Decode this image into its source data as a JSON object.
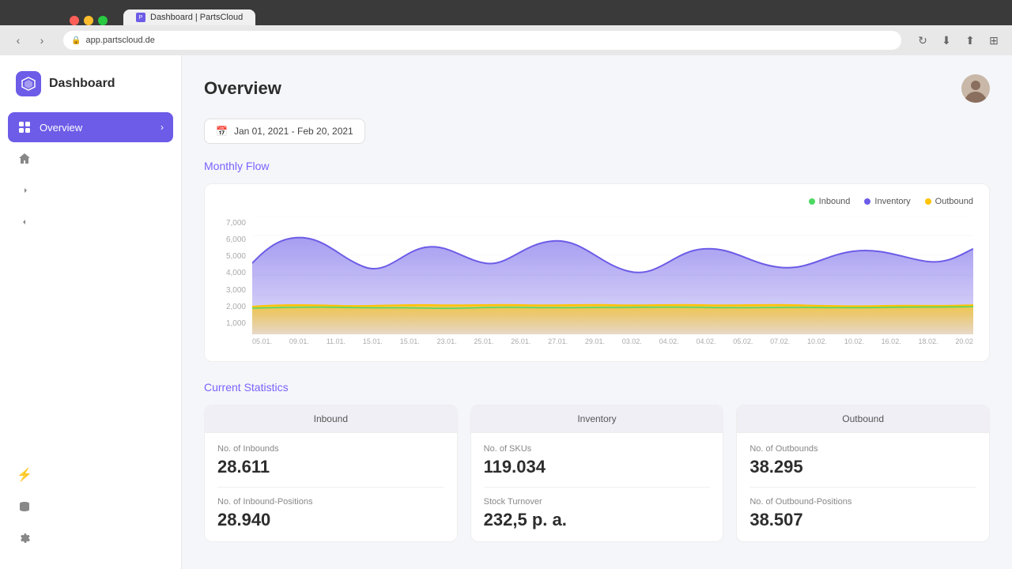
{
  "browser": {
    "tab_title": "Dashboard | PartsCloud",
    "url": "app.partscloud.de",
    "back_btn": "‹",
    "forward_btn": "›"
  },
  "sidebar": {
    "app_name": "Dashboard",
    "logo_symbol": "⬡",
    "nav_items": [
      {
        "id": "overview",
        "label": "Overview",
        "icon": "⊙",
        "active": true
      },
      {
        "id": "home",
        "label": "Home",
        "icon": "⌂",
        "active": false
      },
      {
        "id": "inbound",
        "label": "Inbound",
        "icon": "→",
        "active": false
      },
      {
        "id": "outbound",
        "label": "Outbound",
        "icon": "↗",
        "active": false
      }
    ],
    "bottom_items": [
      {
        "id": "lightning",
        "label": "",
        "icon": "⚡"
      },
      {
        "id": "database",
        "label": "",
        "icon": "⊟"
      },
      {
        "id": "settings",
        "label": "",
        "icon": "⊞"
      }
    ]
  },
  "header": {
    "title": "Overview",
    "date_range": "Jan 01, 2021 - Feb 20, 2021"
  },
  "monthly_flow": {
    "section_title": "Monthly Flow",
    "legend": [
      {
        "label": "Inbound",
        "color": "#4cd964"
      },
      {
        "label": "Inventory",
        "color": "#6c5ce7"
      },
      {
        "label": "Outbound",
        "color": "#ffc300"
      }
    ],
    "y_labels": [
      "7,000",
      "6,000",
      "5,000",
      "4,000",
      "3,000",
      "2,000",
      "1,000"
    ],
    "x_labels": [
      "05.01.",
      "09.01.",
      "11.01.",
      "15.01.",
      "15.01.",
      "23.01.",
      "25.01.",
      "26.01.",
      "27.01.",
      "29.01.",
      "03.02.",
      "04.02.",
      "04.02.",
      "05.02.",
      "07.02.",
      "10.02.",
      "10.02.",
      "16.02.",
      "18.02.",
      "20.02"
    ]
  },
  "current_statistics": {
    "section_title": "Current Statistics",
    "columns": [
      {
        "header": "Inbound",
        "stats": [
          {
            "label": "No. of Inbounds",
            "value": "28.611"
          },
          {
            "label": "No. of Inbound-Positions",
            "value": "28.940"
          }
        ]
      },
      {
        "header": "Inventory",
        "stats": [
          {
            "label": "No. of SKUs",
            "value": "119.034"
          },
          {
            "label": "Stock Turnover",
            "value": "232,5 p. a."
          }
        ]
      },
      {
        "header": "Outbound",
        "stats": [
          {
            "label": "No. of Outbounds",
            "value": "38.295"
          },
          {
            "label": "No. of Outbound-Positions",
            "value": "38.507"
          }
        ]
      }
    ]
  },
  "colors": {
    "accent": "#6c5ce7",
    "inbound_color": "#4cd964",
    "inventory_color": "#6c5ce7",
    "outbound_color": "#ffc300"
  }
}
